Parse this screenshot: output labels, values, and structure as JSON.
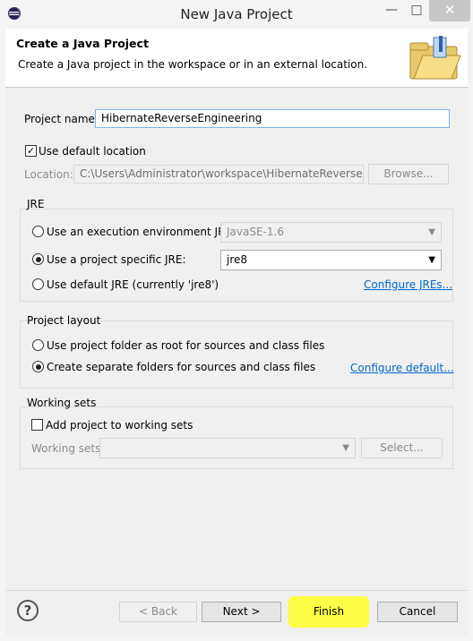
{
  "window": {
    "title": "New Java Project",
    "minimize_symbol": "—",
    "maximize_symbol": "□",
    "close_symbol": "✕"
  },
  "banner": {
    "title": "Create a Java Project",
    "description": "Create a Java project in the workspace or in an external location."
  },
  "project_name": {
    "label": "Project name:",
    "value": "HibernateReverseEngineering"
  },
  "location": {
    "use_default_label": "Use default location",
    "use_default_checked": true,
    "label": "Location:",
    "value": "C:\\Users\\Administrator\\workspace\\HibernateReverseEngine",
    "browse_label": "Browse..."
  },
  "jre": {
    "title": "JRE",
    "options": [
      {
        "label": "Use an execution environment JRE:",
        "selected": false
      },
      {
        "label": "Use a project specific JRE:",
        "selected": true
      },
      {
        "label": "Use default JRE (currently 'jre8')",
        "selected": false
      }
    ],
    "env_combo_value": "JavaSE-1.6",
    "specific_combo_value": "jre8",
    "configure_link": "Configure JREs..."
  },
  "project_layout": {
    "title": "Project layout",
    "options": [
      {
        "label": "Use project folder as root for sources and class files",
        "selected": false
      },
      {
        "label": "Create separate folders for sources and class files",
        "selected": true
      }
    ],
    "configure_link": "Configure default..."
  },
  "working_sets": {
    "title": "Working sets",
    "add_label": "Add project to working sets",
    "add_checked": false,
    "label": "Working sets:",
    "select_label": "Select..."
  },
  "footer": {
    "help_symbol": "?",
    "back_label": "< Back",
    "next_label": "Next >",
    "finish_label": "Finish",
    "cancel_label": "Cancel",
    "highlight_color": "#ffff33"
  }
}
